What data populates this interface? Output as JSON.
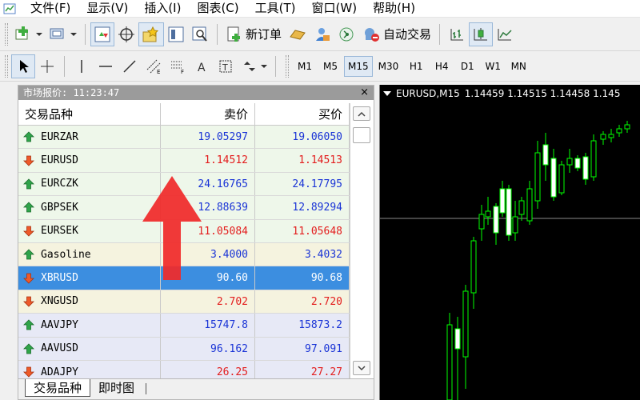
{
  "menu": [
    "文件(F)",
    "显示(V)",
    "插入(I)",
    "图表(C)",
    "工具(T)",
    "窗口(W)",
    "帮助(H)"
  ],
  "toolbar": {
    "new_order_label": "新订单",
    "auto_trading_label": "自动交易"
  },
  "timeframes": [
    "M1",
    "M5",
    "M15",
    "M30",
    "H1",
    "H4",
    "D1",
    "W1",
    "MN"
  ],
  "active_timeframe": "M15",
  "market_watch": {
    "title": "市场报价: 11:23:47",
    "close": "×",
    "columns": {
      "symbol": "交易品种",
      "bid": "卖价",
      "ask": "买价"
    },
    "rows": [
      {
        "symbol": "EURZAR",
        "bid": "19.05297",
        "ask": "19.06050",
        "dir": "up",
        "group": "fx"
      },
      {
        "symbol": "EURUSD",
        "bid": "1.14512",
        "ask": "1.14513",
        "dir": "down",
        "group": "fx"
      },
      {
        "symbol": "EURCZK",
        "bid": "24.16765",
        "ask": "24.17795",
        "dir": "up",
        "group": "fx"
      },
      {
        "symbol": "GBPSEK",
        "bid": "12.88639",
        "ask": "12.89294",
        "dir": "up",
        "group": "fx"
      },
      {
        "symbol": "EURSEK",
        "bid": "11.05084",
        "ask": "11.05648",
        "dir": "down",
        "group": "fx"
      },
      {
        "symbol": "Gasoline",
        "bid": "3.4000",
        "ask": "3.4032",
        "dir": "up",
        "group": "comm"
      },
      {
        "symbol": "XBRUSD",
        "bid": "90.60",
        "ask": "90.68",
        "dir": "down",
        "group": "comm",
        "selected": true
      },
      {
        "symbol": "XNGUSD",
        "bid": "2.702",
        "ask": "2.720",
        "dir": "down",
        "group": "comm"
      },
      {
        "symbol": "AAVJPY",
        "bid": "15747.8",
        "ask": "15873.2",
        "dir": "up",
        "group": "stock"
      },
      {
        "symbol": "AAVUSD",
        "bid": "96.162",
        "ask": "97.091",
        "dir": "up",
        "group": "stock"
      },
      {
        "symbol": "ADAJPY",
        "bid": "26.25",
        "ask": "27.27",
        "dir": "down",
        "group": "stock"
      }
    ],
    "tabs": [
      "交易品种",
      "即时图"
    ]
  },
  "chart": {
    "symbol_tf": "EURUSD,M15",
    "ohlc": "1.14459 1.14515 1.14458 1.145"
  },
  "colors": {
    "up_price": "#1a34d6",
    "down_price": "#e31d1d",
    "selected_row": "#3c8ee0",
    "candle": "#00ff00",
    "annotation": "#f02a2a"
  }
}
